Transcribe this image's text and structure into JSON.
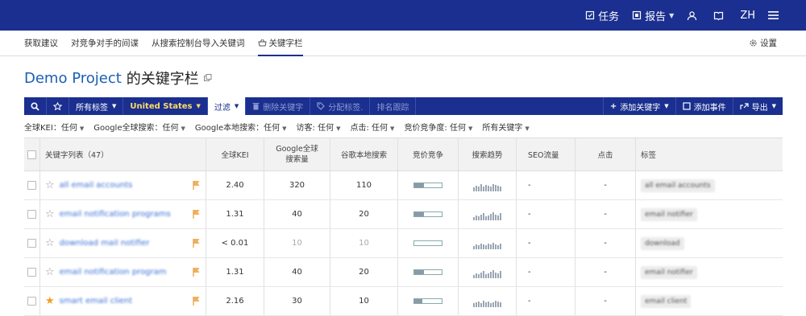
{
  "topbar": {
    "tasks": "任务",
    "reports": "报告",
    "lang": "ZH"
  },
  "nav": {
    "tabs": [
      "获取建议",
      "对竞争对手的间谍",
      "从搜索控制台导入关键词",
      "关键字栏"
    ],
    "settings": "设置"
  },
  "page": {
    "project": "Demo Project",
    "title_rest": "的关键字栏"
  },
  "toolbar": {
    "all_tags": "所有标签",
    "country": "United States",
    "filter": "过滤",
    "delete": "删除关键字",
    "assign_tag": "分配标签.",
    "rank_track": "排名跟踪",
    "add_keyword": "添加关键字",
    "add_event": "添加事件",
    "export": "导出"
  },
  "filters": [
    "全球KEI：任何",
    "Google全球搜索：任何",
    "Google本地搜索：任何",
    "访客: 任何",
    "点击: 任何",
    "竞价竞争度: 任何",
    "所有关键字"
  ],
  "table": {
    "headers": {
      "keyword": "关键字列表（47）",
      "kei": "全球KEI",
      "global_search": "Google全球搜索量",
      "local_search": "谷歌本地搜索",
      "competition": "竞价竞争",
      "trend": "搜索趋势",
      "seo": "SEO流量",
      "clicks": "点击",
      "tags": "标签"
    },
    "rows": [
      {
        "keyword": "all email accounts",
        "starred": false,
        "kei": "2.40",
        "global": "320",
        "local": "110",
        "dim": false,
        "comp": 0.35,
        "trend": [
          5,
          7,
          6,
          9,
          6,
          8,
          7,
          6,
          9,
          8,
          7,
          6
        ],
        "seo": "-",
        "clicks": "-",
        "tag": "all email accounts"
      },
      {
        "keyword": "email notification programs",
        "starred": false,
        "kei": "1.31",
        "global": "40",
        "local": "20",
        "dim": false,
        "comp": 0.35,
        "trend": [
          4,
          6,
          5,
          7,
          9,
          5,
          6,
          8,
          10,
          7,
          6,
          9
        ],
        "seo": "-",
        "clicks": "-",
        "tag": "email notifier"
      },
      {
        "keyword": "download mail notifier",
        "starred": false,
        "kei": "< 0.01",
        "global": "10",
        "local": "10",
        "dim": true,
        "comp": 0.0,
        "trend": [
          4,
          6,
          5,
          7,
          6,
          5,
          7,
          6,
          8,
          6,
          5,
          7
        ],
        "seo": "-",
        "clicks": "-",
        "tag": "download"
      },
      {
        "keyword": "email notification program",
        "starred": false,
        "kei": "1.31",
        "global": "40",
        "local": "20",
        "dim": false,
        "comp": 0.35,
        "trend": [
          4,
          6,
          5,
          7,
          9,
          5,
          6,
          8,
          10,
          7,
          6,
          9
        ],
        "seo": "-",
        "clicks": "-",
        "tag": "email notifier"
      },
      {
        "keyword": "smart email client",
        "starred": true,
        "kei": "2.16",
        "global": "30",
        "local": "10",
        "dim": false,
        "comp": 0.3,
        "trend": [
          5,
          6,
          7,
          5,
          8,
          6,
          7,
          5,
          6,
          8,
          7,
          6
        ],
        "seo": "-",
        "clicks": "-",
        "tag": "email client"
      }
    ]
  }
}
